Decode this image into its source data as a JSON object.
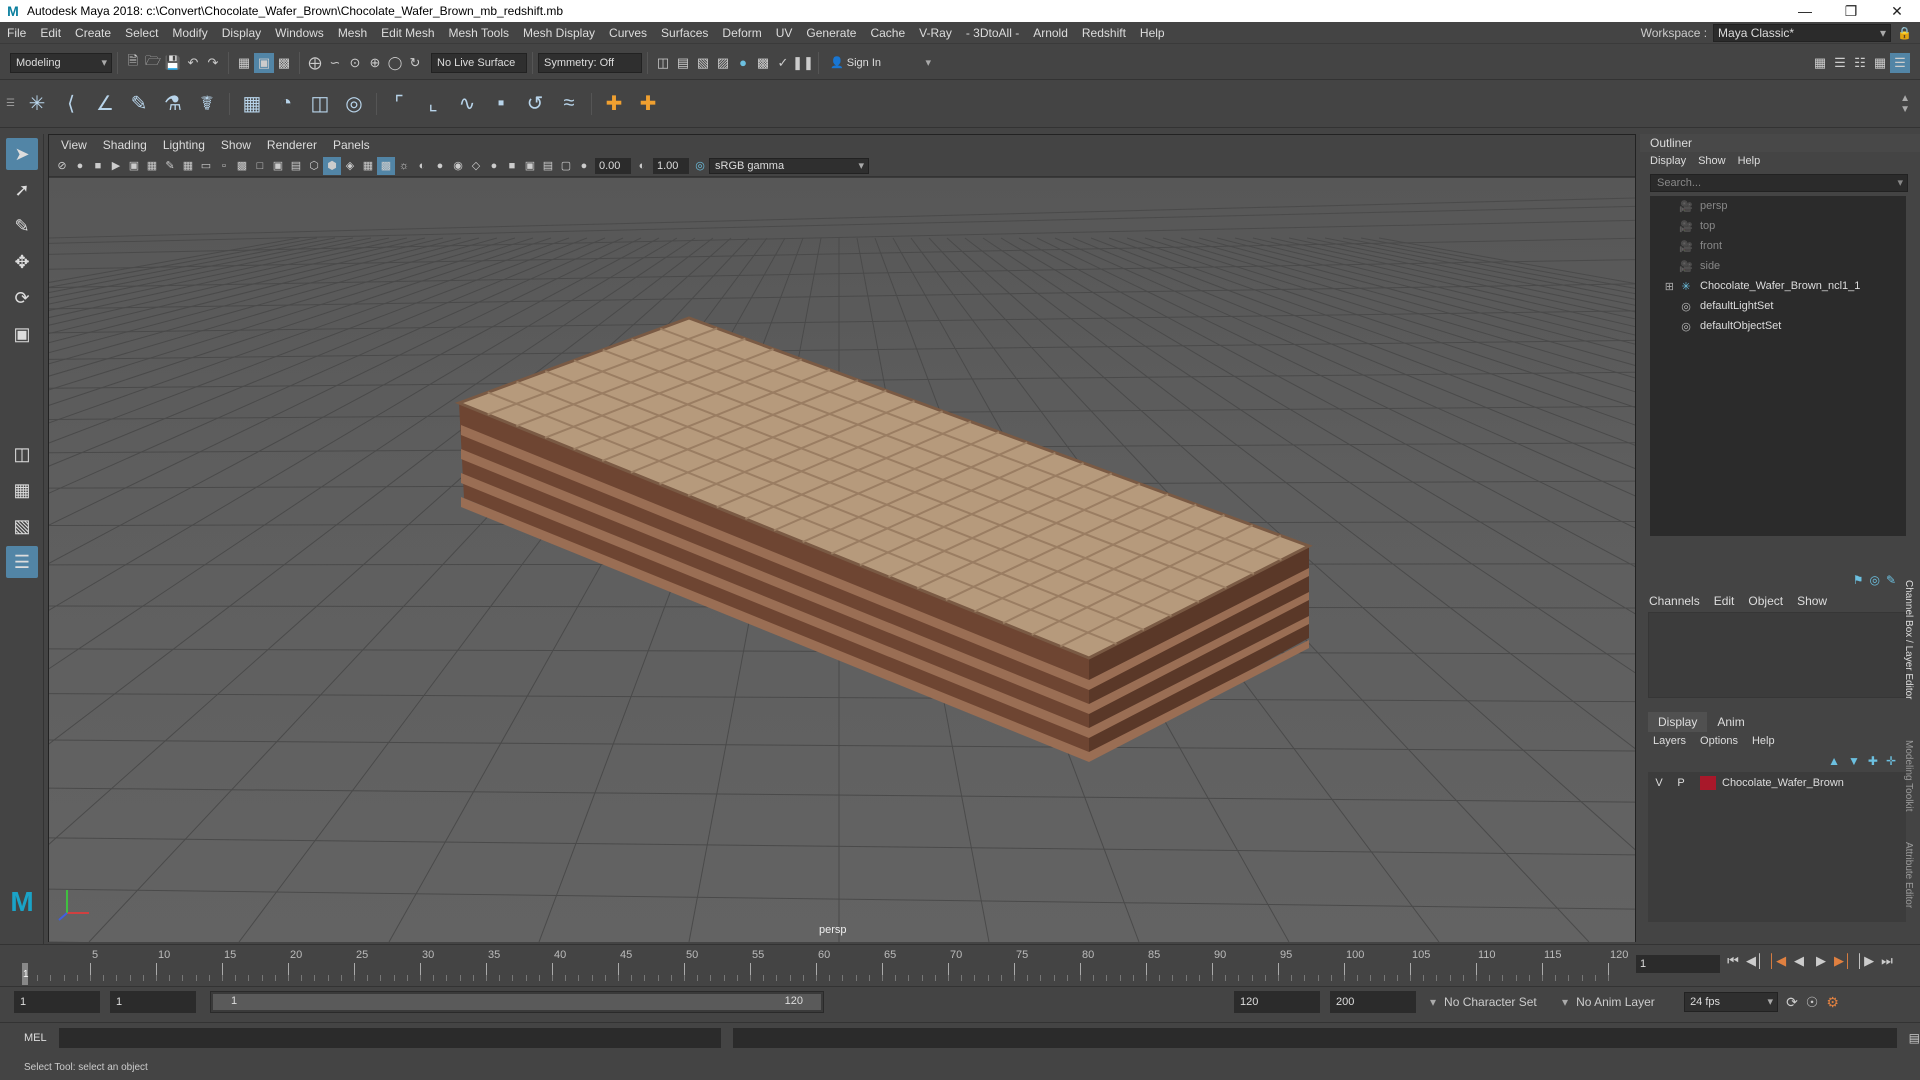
{
  "window": {
    "title": "Autodesk Maya 2018: c:\\Convert\\Chocolate_Wafer_Brown\\Chocolate_Wafer_Brown_mb_redshift.mb",
    "app_icon": "M"
  },
  "menubar": {
    "items": [
      "File",
      "Edit",
      "Create",
      "Select",
      "Modify",
      "Display",
      "Windows",
      "Mesh",
      "Edit Mesh",
      "Mesh Tools",
      "Mesh Display",
      "Curves",
      "Surfaces",
      "Deform",
      "UV",
      "Generate",
      "Cache",
      "V-Ray",
      "- 3DtoAll -",
      "Arnold",
      "Redshift",
      "Help"
    ],
    "workspace_label": "Workspace :",
    "workspace_value": "Maya Classic*"
  },
  "statusline": {
    "mode": "Modeling",
    "live_surface": "No Live Surface",
    "symmetry": "Symmetry: Off",
    "sign_in": "Sign In"
  },
  "viewport": {
    "menu": [
      "View",
      "Shading",
      "Lighting",
      "Show",
      "Renderer",
      "Panels"
    ],
    "exposure": "0.00",
    "gamma": "1.00",
    "color_space": "sRGB gamma",
    "camera_label": "persp"
  },
  "outliner": {
    "title": "Outliner",
    "menu": [
      "Display",
      "Show",
      "Help"
    ],
    "search_placeholder": "Search...",
    "items": [
      {
        "label": "persp",
        "icon": "camera-icon",
        "dim": true
      },
      {
        "label": "top",
        "icon": "camera-icon",
        "dim": true
      },
      {
        "label": "front",
        "icon": "camera-icon",
        "dim": true
      },
      {
        "label": "side",
        "icon": "camera-icon",
        "dim": true
      },
      {
        "label": "Chocolate_Wafer_Brown_ncl1_1",
        "icon": "group-icon",
        "dim": false
      },
      {
        "label": "defaultLightSet",
        "icon": "set-icon",
        "dim": false
      },
      {
        "label": "defaultObjectSet",
        "icon": "set-icon",
        "dim": false
      }
    ]
  },
  "channelbox": {
    "menu": [
      "Channels",
      "Edit",
      "Object",
      "Show"
    ]
  },
  "side_tabs": [
    "Channel Box / Layer Editor",
    "Modeling Toolkit",
    "Attribute Editor"
  ],
  "layers": {
    "tabs": [
      "Display",
      "Anim"
    ],
    "menu": [
      "Layers",
      "Options",
      "Help"
    ],
    "rows": [
      {
        "v": "V",
        "p": "P",
        "name": "Chocolate_Wafer_Brown",
        "color": "#a8182a"
      }
    ]
  },
  "timeline": {
    "ticks": [
      "5",
      "10",
      "15",
      "20",
      "25",
      "30",
      "35",
      "40",
      "45",
      "50",
      "55",
      "60",
      "65",
      "70",
      "75",
      "80",
      "85",
      "90",
      "95",
      "100",
      "105",
      "110",
      "115",
      "120"
    ],
    "current_frame": "1",
    "current_marker": "1"
  },
  "range": {
    "start": "1",
    "inner_start": "1",
    "bar_start": "1",
    "bar_end": "120",
    "end": "120",
    "anim_end": "200",
    "character_set": "No Character Set",
    "anim_layer": "No Anim Layer",
    "fps": "24 fps"
  },
  "cmdline": {
    "label": "MEL"
  },
  "helpline": {
    "text": "Select Tool: select an object"
  },
  "colors": {
    "accent": "#5285a6",
    "layer_color": "#a8182a",
    "wafer_top": "#b69a7c",
    "wafer_side": "#7a4e38"
  }
}
